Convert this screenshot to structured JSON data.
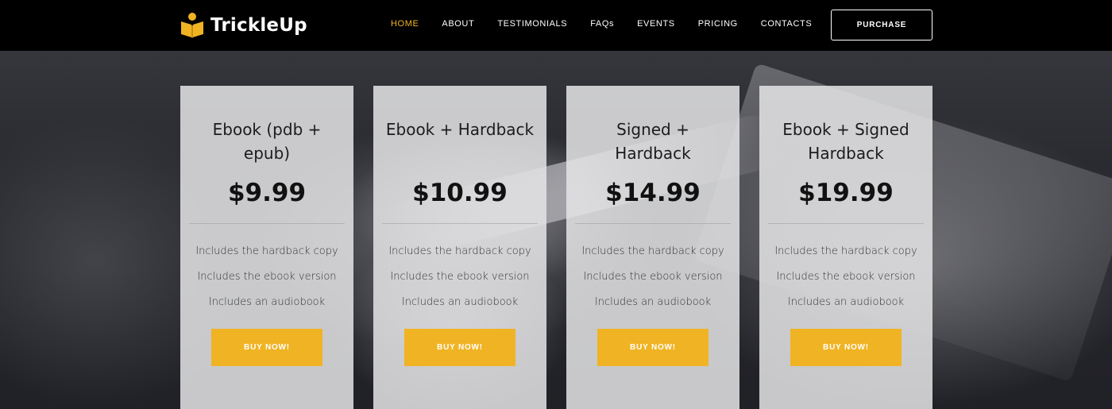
{
  "brand": {
    "name": "TrickleUp",
    "accent_color": "#f0b323",
    "logo_icon": "open-book-person-icon"
  },
  "nav": {
    "items": [
      {
        "label": "HOME",
        "active": true
      },
      {
        "label": "ABOUT",
        "active": false
      },
      {
        "label": "TESTIMONIALS",
        "active": false
      },
      {
        "label": "FAQs",
        "active": false
      },
      {
        "label": "EVENTS",
        "active": false
      },
      {
        "label": "PRICING",
        "active": false
      },
      {
        "label": "CONTACTS",
        "active": false
      }
    ],
    "purchase_label": "PURCHASE"
  },
  "pricing": {
    "plans": [
      {
        "title": "Ebook (pdb + epub)",
        "price": "$9.99",
        "features": [
          "Includes the hardback copy",
          "Includes the ebook version",
          "Includes an audiobook"
        ],
        "button_label": "BUY NOW!"
      },
      {
        "title": "Ebook + Hardback",
        "price": "$10.99",
        "features": [
          "Includes the hardback copy",
          "Includes the ebook version",
          "Includes an audiobook"
        ],
        "button_label": "BUY NOW!"
      },
      {
        "title": "Signed + Hardback",
        "price": "$14.99",
        "features": [
          "Includes the hardback copy",
          "Includes the ebook version",
          "Includes an audiobook"
        ],
        "button_label": "BUY NOW!"
      },
      {
        "title": "Ebook + Signed Hardback",
        "price": "$19.99",
        "features": [
          "Includes the hardback copy",
          "Includes the ebook version",
          "Includes an audiobook"
        ],
        "button_label": "BUY NOW!"
      }
    ]
  }
}
